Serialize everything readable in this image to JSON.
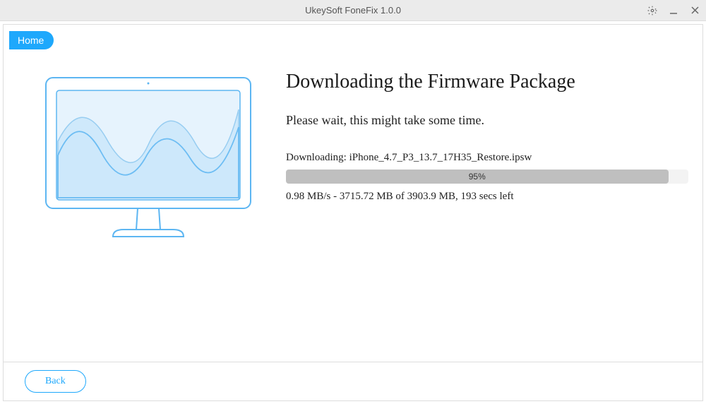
{
  "window": {
    "title": "UkeySoft FoneFix 1.0.0"
  },
  "nav": {
    "home_label": "Home"
  },
  "content": {
    "heading": "Downloading the Firmware Package",
    "subheading": "Please wait, this might take some time.",
    "filename_label": "Downloading: iPhone_4.7_P3_13.7_17H35_Restore.ipsw",
    "progress_percent": "95%",
    "progress_width": "95%",
    "stats": "0.98 MB/s - 3715.72 MB of 3903.9 MB, 193 secs left"
  },
  "footer": {
    "back_label": "Back"
  }
}
